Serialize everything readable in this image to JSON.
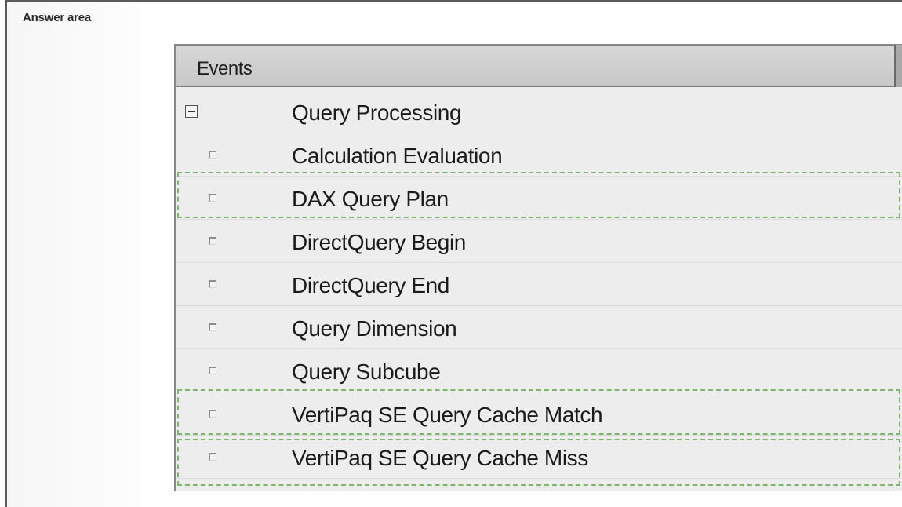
{
  "answer_area_label": "Answer area",
  "panel": {
    "header": "Events"
  },
  "rows": [
    {
      "label": "Query Processing",
      "type": "category"
    },
    {
      "label": "Calculation Evaluation",
      "type": "event"
    },
    {
      "label": "DAX Query Plan",
      "type": "event"
    },
    {
      "label": "DirectQuery Begin",
      "type": "event"
    },
    {
      "label": "DirectQuery End",
      "type": "event"
    },
    {
      "label": "Query Dimension",
      "type": "event"
    },
    {
      "label": "Query Subcube",
      "type": "event"
    },
    {
      "label": "VertiPaq SE Query Cache Match",
      "type": "event"
    },
    {
      "label": "VertiPaq SE Query Cache Miss",
      "type": "event"
    }
  ],
  "drop_targets": [
    "DAX Query Plan",
    "VertiPaq SE Query Cache Match",
    "VertiPaq SE Query Cache Miss"
  ],
  "colors": {
    "drop_target_dash": "#7fb56e",
    "panel_background": "#ededed",
    "header_background": "#cdcdcd"
  },
  "icons": {
    "category": "collapse-icon",
    "event": "checkbox-icon"
  }
}
